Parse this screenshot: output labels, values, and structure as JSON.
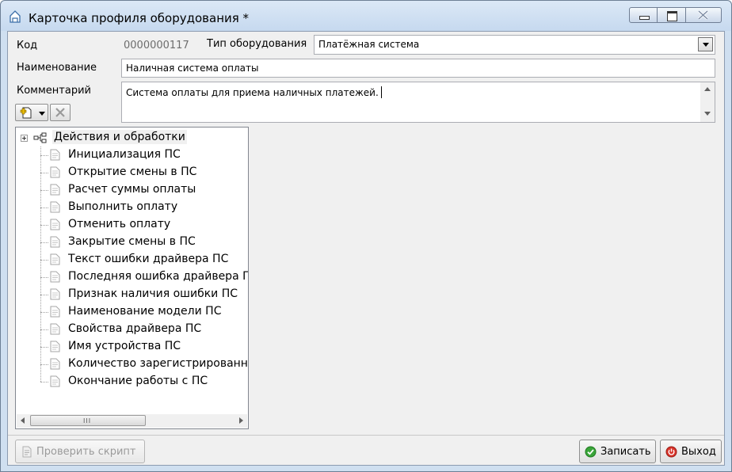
{
  "window": {
    "title": "Карточка профиля оборудования *",
    "controls": {
      "minimize": "minimize-icon",
      "maximize": "maximize-icon",
      "close": "close-icon"
    }
  },
  "form": {
    "code_label": "Код",
    "code_value": "0000000117",
    "equipment_type_label": "Тип оборудования",
    "equipment_type_value": "Платёжная система",
    "name_label": "Наименование",
    "name_value": "Наличная система оплаты",
    "comment_label": "Комментарий",
    "comment_value": "Система оплаты для приема наличных платежей."
  },
  "toolbar": {
    "add_icon": "add-item-icon",
    "delete_icon": "delete-icon"
  },
  "tree": {
    "root_label": "Действия и обработки",
    "items": [
      "Инициализация ПС",
      "Открытие смены в ПС",
      "Расчет суммы оплаты",
      "Выполнить оплату",
      "Отменить оплату",
      "Закрытие смены в ПС",
      "Текст ошибки драйвера ПС",
      "Последняя ошибка драйвера ПС",
      "Признак наличия ошибки ПС",
      "Наименование модели ПС",
      "Свойства драйвера ПС",
      "Имя устройства ПС",
      "Количество зарегистрированных",
      "Окончание работы с ПС"
    ],
    "scroll_grip": "III"
  },
  "buttons": {
    "check_script": "Проверить скрипт",
    "save": "Записать",
    "exit": "Выход"
  },
  "colors": {
    "title_bg": "#c6d9ef",
    "client_bg": "#f0f0f0",
    "save_icon": "#3aa53a",
    "exit_icon": "#d9342b"
  }
}
